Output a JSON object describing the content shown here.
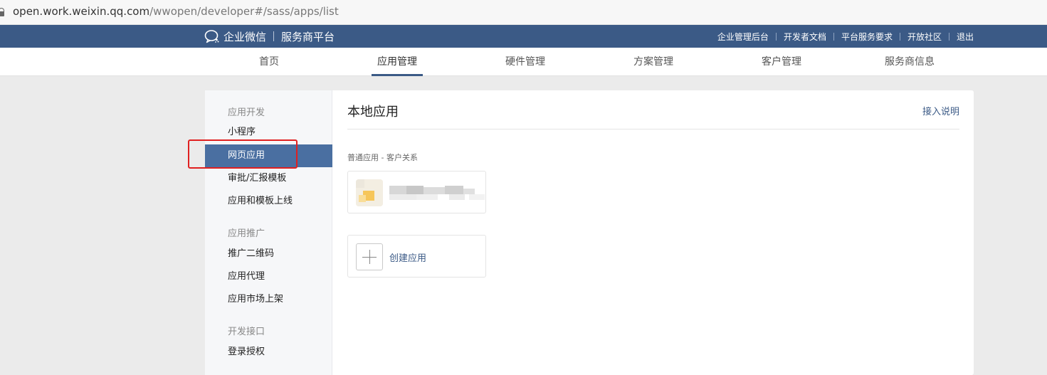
{
  "browser": {
    "url_host": "open.work.weixin.qq.com",
    "url_path": "/wwopen/developer#/sass/apps/list"
  },
  "topbar": {
    "brand_name": "企业微信",
    "brand_sub": "服务商平台",
    "links": [
      "企业管理后台",
      "开发者文档",
      "平台服务要求",
      "开放社区",
      "退出"
    ]
  },
  "mainnav": {
    "tabs": [
      "首页",
      "应用管理",
      "硬件管理",
      "方案管理",
      "客户管理",
      "服务商信息"
    ],
    "active": "应用管理"
  },
  "sidebar": {
    "groups": [
      {
        "title": "应用开发",
        "items": [
          "小程序",
          "网页应用",
          "审批/汇报模板",
          "应用和模板上线"
        ]
      },
      {
        "title": "应用推广",
        "items": [
          "推广二维码",
          "应用代理",
          "应用市场上架"
        ]
      },
      {
        "title": "开发接口",
        "items": [
          "登录授权"
        ]
      }
    ],
    "active_item": "网页应用"
  },
  "content": {
    "title": "本地应用",
    "help_link": "接入说明",
    "section_label": "普通应用 - 客户关系",
    "create_label": "创建应用"
  },
  "colors": {
    "brand_blue": "#3b5a86",
    "sidebar_active": "#4a6fa1",
    "highlight_red": "#e02020"
  }
}
